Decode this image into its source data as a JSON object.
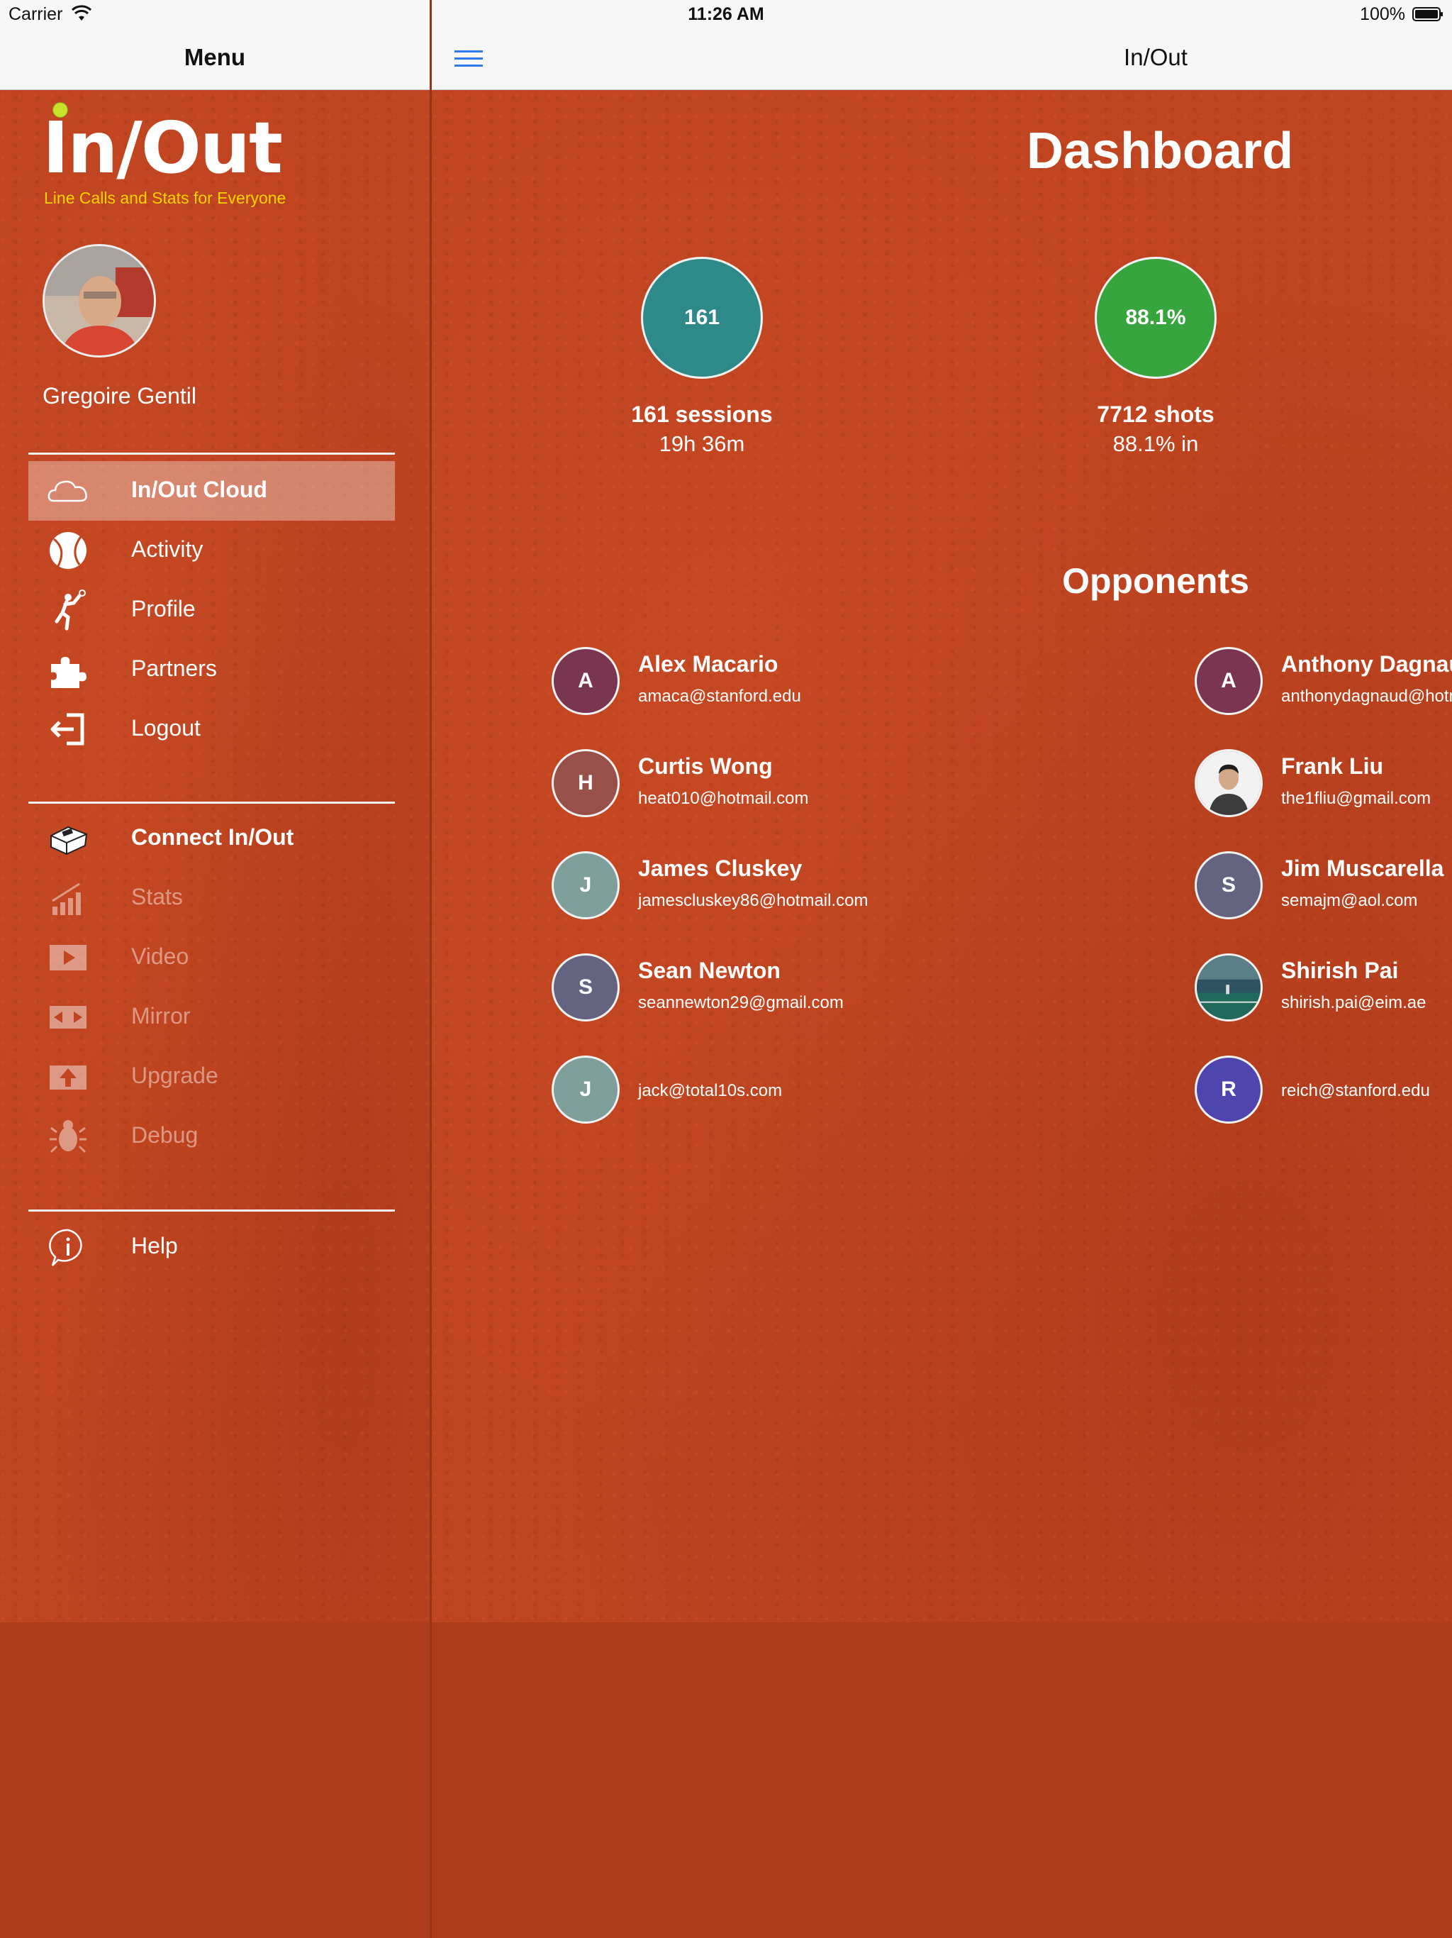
{
  "status_bar": {
    "carrier": "Carrier",
    "time": "11:26 AM",
    "battery": "100%"
  },
  "sidebar": {
    "header_title": "Menu",
    "logo": {
      "text": "In/Out",
      "tagline": "Line Calls and Stats for Everyone"
    },
    "user_name": "Gregoire Gentil",
    "items": [
      {
        "label": "In/Out Cloud",
        "icon": "cloud-icon",
        "selected": true,
        "bold": true
      },
      {
        "label": "Activity",
        "icon": "tennis-ball-icon"
      },
      {
        "label": "Profile",
        "icon": "tennis-player-icon"
      },
      {
        "label": "Partners",
        "icon": "puzzle-icon"
      },
      {
        "label": "Logout",
        "icon": "logout-icon"
      },
      {
        "label": "Connect In/Out",
        "icon": "device-icon",
        "bold": true
      },
      {
        "label": "Stats",
        "icon": "stats-icon",
        "disabled": true
      },
      {
        "label": "Video",
        "icon": "video-icon",
        "disabled": true
      },
      {
        "label": "Mirror",
        "icon": "mirror-icon",
        "disabled": true
      },
      {
        "label": "Upgrade",
        "icon": "upgrade-icon",
        "disabled": true
      },
      {
        "label": "Debug",
        "icon": "bug-icon",
        "disabled": true
      },
      {
        "label": "Help",
        "icon": "info-icon"
      }
    ]
  },
  "main": {
    "header_title": "In/Out",
    "dashboard_title": "Dashboard",
    "stats": [
      {
        "circle": "161",
        "line1": "161 sessions",
        "line2": "19h 36m",
        "color": "#2e8a88"
      },
      {
        "circle": "88.1%",
        "line1": "7712 shots",
        "line2": "88.1% in",
        "color": "#36a53e"
      }
    ],
    "opponents_title": "Opponents",
    "opponents_left": [
      {
        "initial": "A",
        "name": "Alex Macario",
        "email": "amaca@stanford.edu",
        "color": "#7a3550"
      },
      {
        "initial": "H",
        "name": "Curtis Wong",
        "email": "heat010@hotmail.com",
        "color": "#98504a"
      },
      {
        "initial": "J",
        "name": "James Cluskey",
        "email": "jamescluskey86@hotmail.com",
        "color": "#7fa09a"
      },
      {
        "initial": "S",
        "name": "Sean Newton",
        "email": "seannewton29@gmail.com",
        "color": "#656480"
      },
      {
        "initial": "J",
        "name": "",
        "email": "jack@total10s.com",
        "color": "#7fa09a"
      }
    ],
    "opponents_right": [
      {
        "initial": "A",
        "name": "Anthony Dagnaud",
        "email": "anthonydagnaud@hotmail.com",
        "color": "#7a3550"
      },
      {
        "initial": "",
        "name": "Frank Liu",
        "email": "the1fliu@gmail.com",
        "color": "#f4f4f4",
        "photo": true
      },
      {
        "initial": "S",
        "name": "Jim Muscarella",
        "email": "semajm@aol.com",
        "color": "#656480"
      },
      {
        "initial": "",
        "name": "Shirish Pai",
        "email": "shirish.pai@eim.ae",
        "color": "#2f5260",
        "photo": true
      },
      {
        "initial": "R",
        "name": "",
        "email": "reich@stanford.edu",
        "color": "#4f45ae"
      }
    ]
  }
}
